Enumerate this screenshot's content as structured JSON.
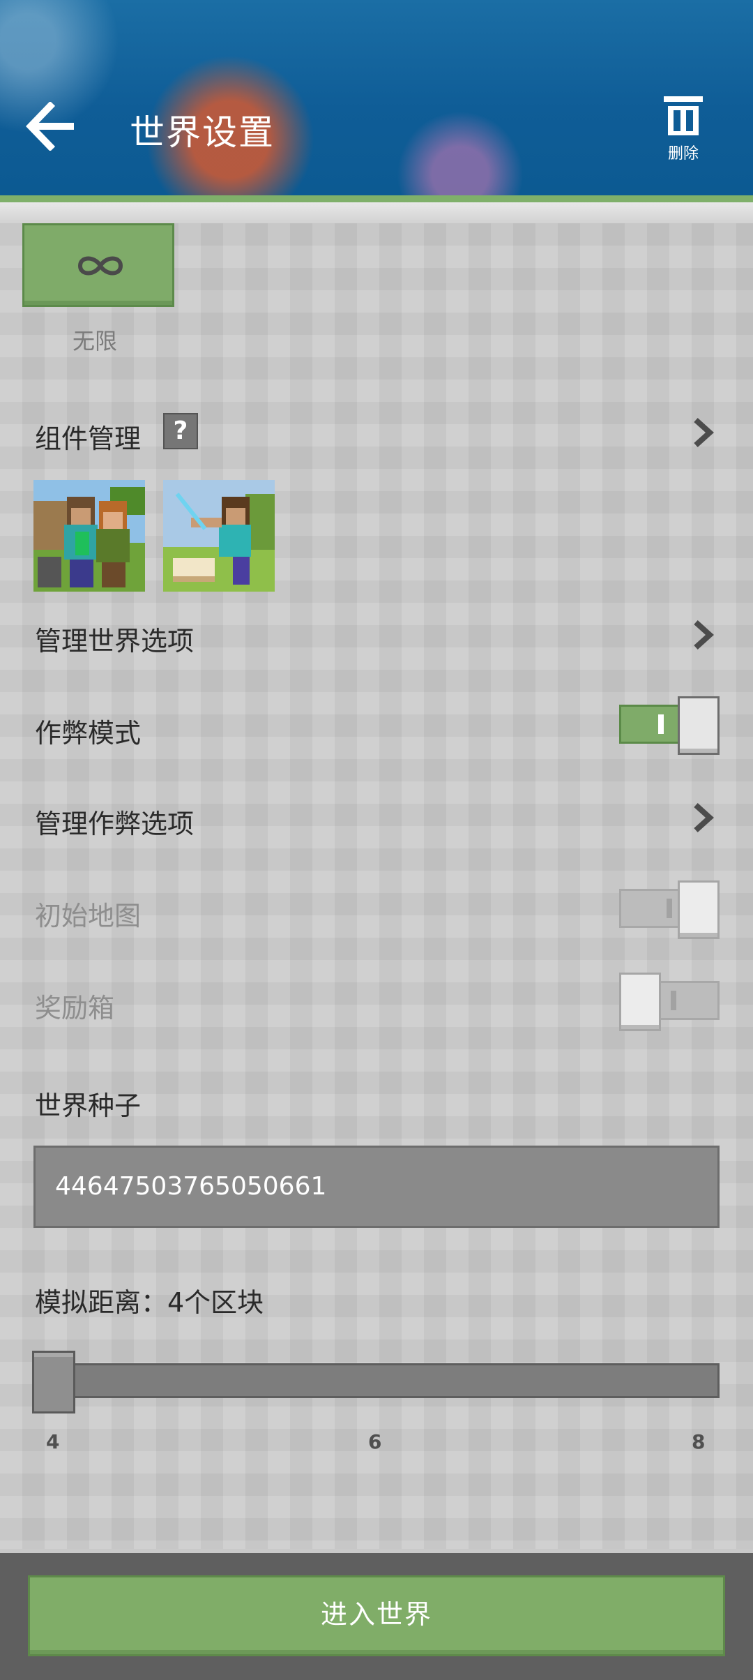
{
  "header": {
    "title": "世界设置",
    "back_icon": "arrow-left-icon",
    "delete_label": "删除",
    "delete_icon": "trash-icon"
  },
  "game_mode": {
    "selected_icon": "infinity-icon",
    "selected_label": "无限"
  },
  "addons": {
    "label": "组件管理",
    "help_glyph": "?",
    "packs": [
      {
        "icon": "skin-pack-thumbnail"
      },
      {
        "icon": "adventure-pack-thumbnail"
      }
    ]
  },
  "settings": {
    "manage_world_options": "管理世界选项",
    "cheats_label": "作弊模式",
    "cheats_on": true,
    "manage_cheats": "管理作弊选项",
    "starting_map_label": "初始地图",
    "starting_map_on": true,
    "bonus_chest_label": "奖励箱",
    "bonus_chest_on": false
  },
  "seed": {
    "label": "世界种子",
    "value": "44647503765050661"
  },
  "simulation": {
    "label": "模拟距离：4个区块",
    "value": 4,
    "min": 4,
    "max": 8,
    "ticks": [
      "4",
      "6",
      "8"
    ]
  },
  "footer": {
    "enter_label": "进入世界"
  },
  "colors": {
    "header_blue": "#0f5d97",
    "accent_green": "#7fab69",
    "text_dark": "#2a2a2a",
    "text_disabled": "#8e8e8e"
  }
}
